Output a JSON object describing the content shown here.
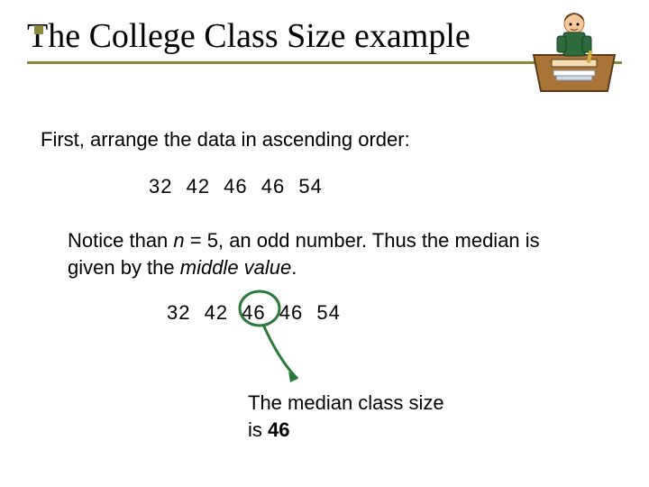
{
  "title": "The College Class Size example",
  "line1": "First, arrange the data in ascending order:",
  "data_row1": "32   42   46   46   54",
  "notice_pre": "Notice than ",
  "notice_n": "n",
  "notice_mid": " = 5, an odd number. Thus the median is given by the ",
  "notice_mv": "middle value",
  "notice_post": ".",
  "data_row2": "32   42   46   46   54",
  "conclusion_pre": "The median class size is ",
  "conclusion_val": "46"
}
